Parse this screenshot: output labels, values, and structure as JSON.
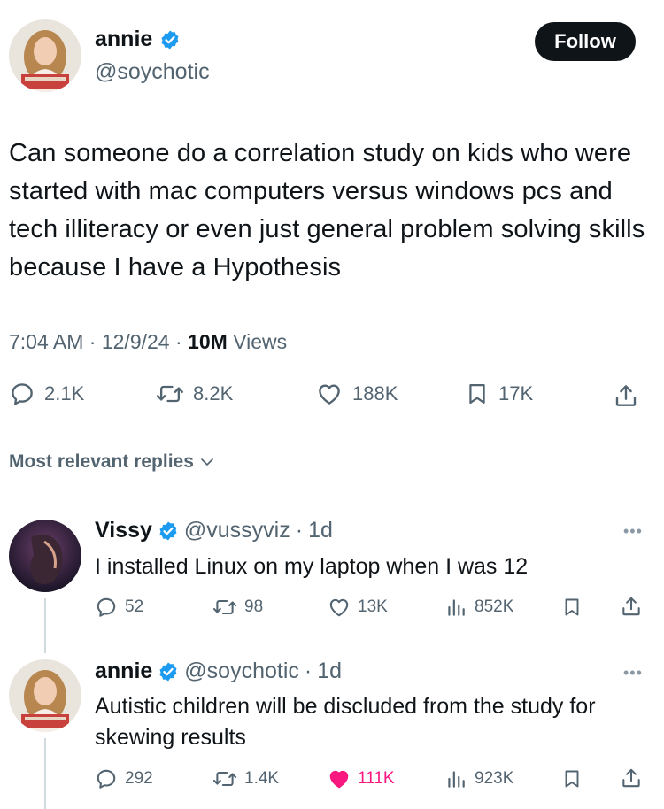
{
  "main_tweet": {
    "author_name": "annie",
    "author_handle": "@soychotic",
    "follow_label": "Follow",
    "text": "Can someone do a correlation study on kids who were started with mac computers versus windows pcs and tech illiteracy or even just general problem solving skills because I have a Hypothesis",
    "time": "7:04 AM",
    "date": "12/9/24",
    "views_count": "10M",
    "views_label": "Views",
    "replies": "2.1K",
    "reposts": "8.2K",
    "likes": "188K",
    "bookmarks": "17K"
  },
  "replies_header": {
    "label": "Most relevant replies"
  },
  "replies": [
    {
      "author_name": "Vissy",
      "author_handle": "@vussyviz",
      "age": "1d",
      "text": "I installed Linux on my laptop when I was 12",
      "replies": "52",
      "reposts": "98",
      "likes": "13K",
      "views": "852K",
      "liked": false
    },
    {
      "author_name": "annie",
      "author_handle": "@soychotic",
      "age": "1d",
      "text": "Autistic children will be discluded from the study for skewing results",
      "replies": "292",
      "reposts": "1.4K",
      "likes": "111K",
      "views": "923K",
      "liked": true
    }
  ],
  "colors": {
    "text": "#0f1419",
    "secondary": "#536471",
    "verified": "#1d9bf0",
    "like_active": "#f91880"
  },
  "icons": [
    "verified-badge-icon",
    "reply-icon",
    "repost-icon",
    "like-icon",
    "bookmark-icon",
    "share-icon",
    "views-icon",
    "chevron-down-icon",
    "more-icon"
  ]
}
